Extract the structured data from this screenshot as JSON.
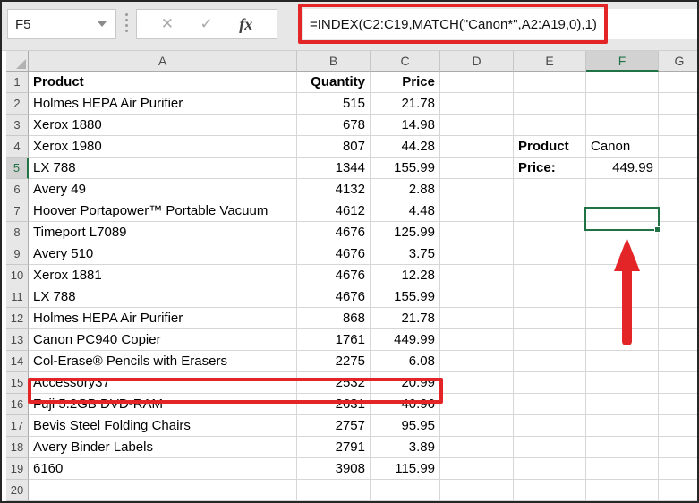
{
  "name_box": {
    "value": "F5"
  },
  "formula_bar": {
    "formula": "=INDEX(C2:C19,MATCH(\"Canon*\",A2:A19,0),1)",
    "cancel_glyph": "✕",
    "enter_glyph": "✓",
    "fx_glyph": "fx"
  },
  "colors": {
    "excel_green": "#217346",
    "annotation_red": "#e42527",
    "header_bg": "#e7e7e7",
    "selected_header_bg": "#d2d2d2",
    "gridline": "#d6d6d6"
  },
  "grid": {
    "column_headers": [
      "A",
      "B",
      "C",
      "D",
      "E",
      "F",
      "G"
    ],
    "selected_column": "F",
    "selected_row": 5,
    "selected_cell": "F5",
    "highlighted_row": 13,
    "table": {
      "headers": {
        "product": "Product",
        "quantity": "Quantity",
        "price": "Price"
      },
      "rows": [
        {
          "product": "Holmes HEPA Air Purifier",
          "quantity": "515",
          "price": "21.78"
        },
        {
          "product": "Xerox 1880",
          "quantity": "678",
          "price": "14.98"
        },
        {
          "product": "Xerox 1980",
          "quantity": "807",
          "price": "44.28"
        },
        {
          "product": "LX 788",
          "quantity": "1344",
          "price": "155.99"
        },
        {
          "product": "Avery 49",
          "quantity": "4132",
          "price": "2.88"
        },
        {
          "product": "Hoover Portapower™ Portable Vacuum",
          "quantity": "4612",
          "price": "4.48"
        },
        {
          "product": "Timeport L7089",
          "quantity": "4676",
          "price": "125.99"
        },
        {
          "product": "Avery 510",
          "quantity": "4676",
          "price": "3.75"
        },
        {
          "product": "Xerox 1881",
          "quantity": "4676",
          "price": "12.28"
        },
        {
          "product": "LX 788",
          "quantity": "4676",
          "price": "155.99"
        },
        {
          "product": "Holmes HEPA Air Purifier",
          "quantity": "868",
          "price": "21.78"
        },
        {
          "product": "Canon PC940 Copier",
          "quantity": "1761",
          "price": "449.99"
        },
        {
          "product": "Col-Erase® Pencils with Erasers",
          "quantity": "2275",
          "price": "6.08"
        },
        {
          "product": "Accessory37",
          "quantity": "2532",
          "price": "20.99"
        },
        {
          "product": "Fuji 5.2GB DVD-RAM",
          "quantity": "2631",
          "price": "40.96"
        },
        {
          "product": "Bevis Steel Folding Chairs",
          "quantity": "2757",
          "price": "95.95"
        },
        {
          "product": "Avery Binder Labels",
          "quantity": "2791",
          "price": "3.89"
        },
        {
          "product": "6160",
          "quantity": "3908",
          "price": "115.99"
        }
      ]
    },
    "lookup": {
      "product_label": "Product",
      "product_value": "Canon",
      "price_label": "Price:",
      "price_value": "449.99"
    }
  }
}
